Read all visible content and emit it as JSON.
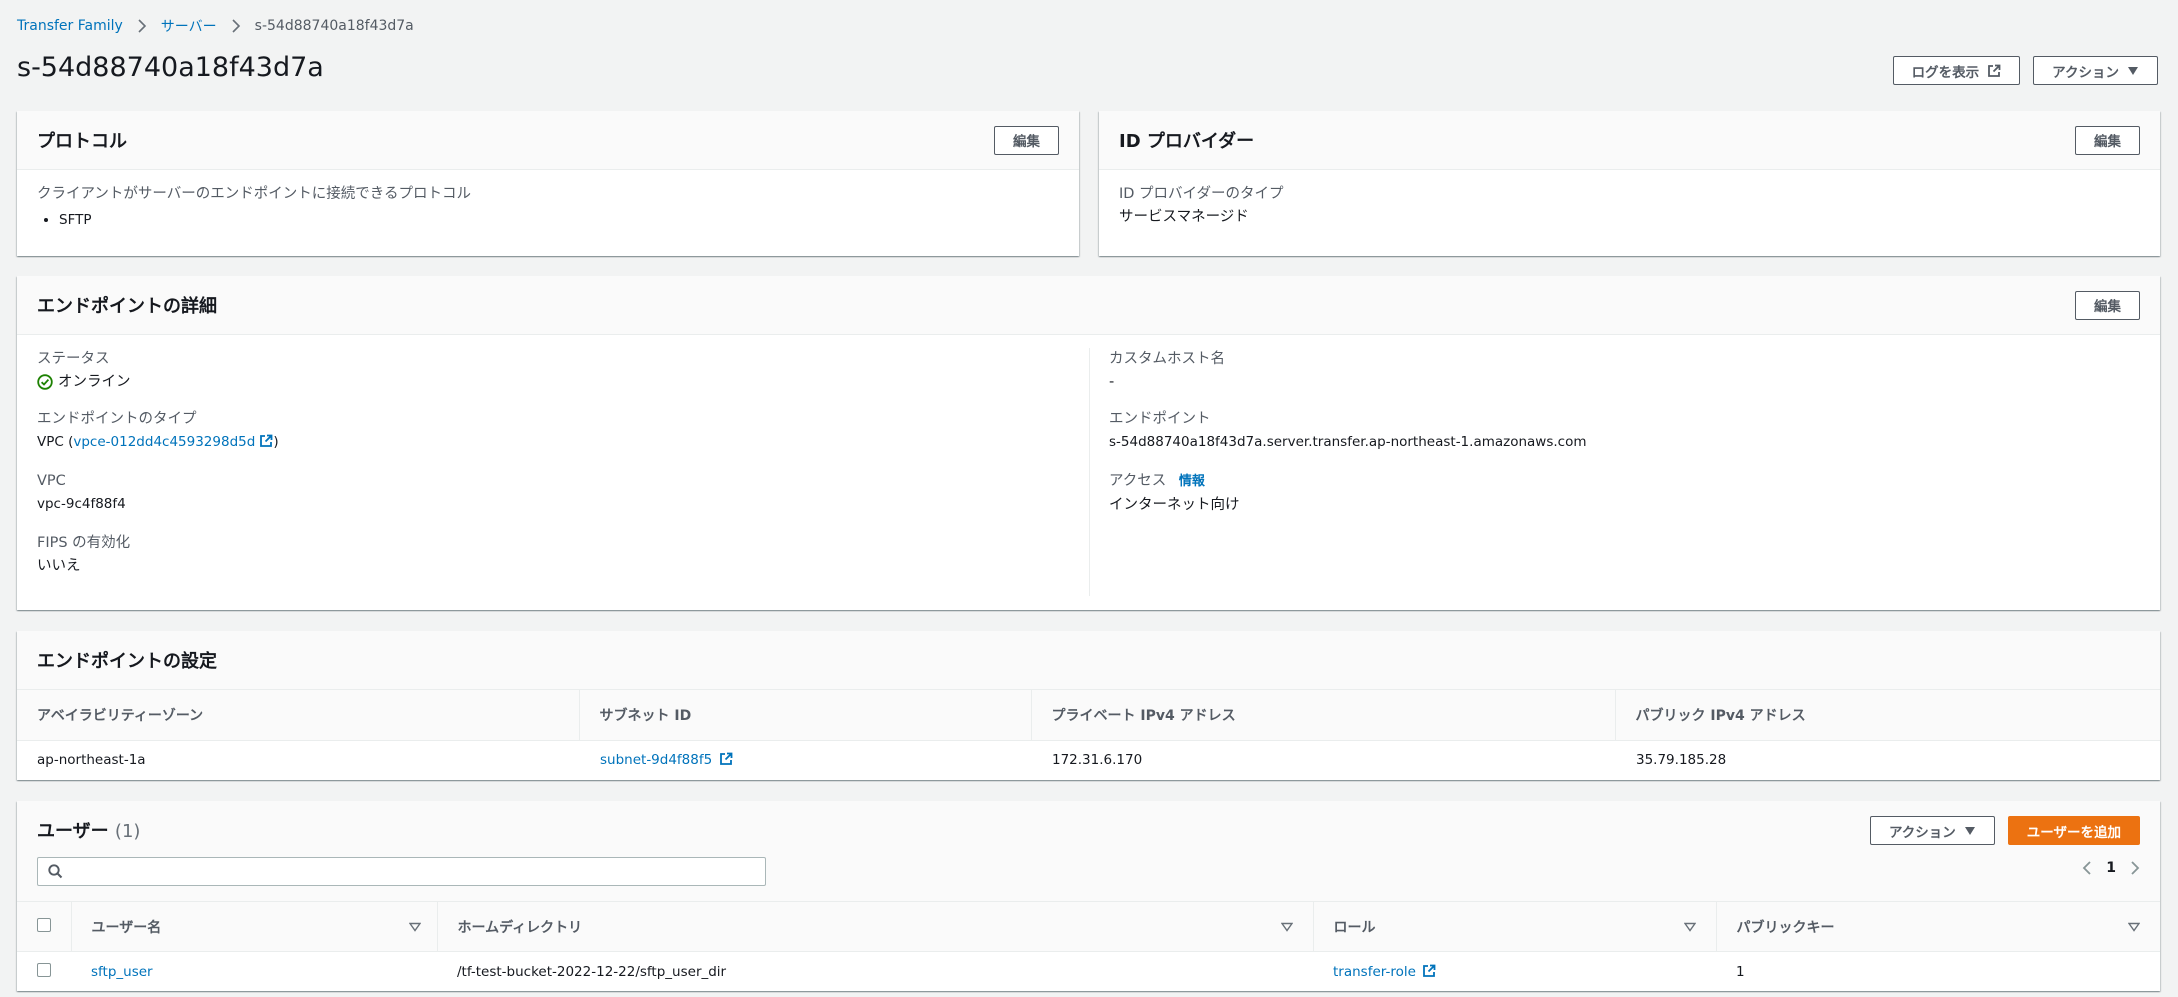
{
  "breadcrumb": {
    "root": "Transfer Family",
    "servers": "サーバー",
    "current": "s-54d88740a18f43d7a"
  },
  "page": {
    "title": "s-54d88740a18f43d7a",
    "view_logs": "ログを表示",
    "actions": "アクション"
  },
  "protocol": {
    "title": "プロトコル",
    "edit": "編集",
    "label": "クライアントがサーバーのエンドポイントに接続できるプロトコル",
    "items": [
      "SFTP"
    ]
  },
  "idp": {
    "title": "ID プロバイダー",
    "edit": "編集",
    "label": "ID プロバイダーのタイプ",
    "value": "サービスマネージド"
  },
  "endpoint_details": {
    "title": "エンドポイントの詳細",
    "edit": "編集",
    "status_label": "ステータス",
    "status_value": "オンライン",
    "type_label": "エンドポイントのタイプ",
    "type_prefix": "VPC (",
    "type_link": "vpce-012dd4c4593298d5d",
    "type_suffix": ")",
    "vpc_label": "VPC",
    "vpc_value": "vpc-9c4f88f4",
    "fips_label": "FIPS の有効化",
    "fips_value": "いいえ",
    "custom_host_label": "カスタムホスト名",
    "custom_host_value": "-",
    "endpoint_label": "エンドポイント",
    "endpoint_value": "s-54d88740a18f43d7a.server.transfer.ap-northeast-1.amazonaws.com",
    "access_label": "アクセス",
    "access_info": "情報",
    "access_value": "インターネット向け"
  },
  "endpoint_config": {
    "title": "エンドポイントの設定",
    "headers": [
      "アベイラビリティーゾーン",
      "サブネット ID",
      "プライベート IPv4 アドレス",
      "パブリック IPv4 アドレス"
    ],
    "row": {
      "az": "ap-northeast-1a",
      "subnet": "subnet-9d4f88f5",
      "private_ip": "172.31.6.170",
      "public_ip": "35.79.185.28"
    }
  },
  "users": {
    "title": "ユーザー",
    "count": "(1)",
    "actions": "アクション",
    "add_user": "ユーザーを追加",
    "search_placeholder": "",
    "page": "1",
    "headers": [
      "ユーザー名",
      "ホームディレクトリ",
      "ロール",
      "パブリックキー"
    ],
    "row": {
      "username": "sftp_user",
      "home": "/tf-test-bucket-2022-12-22/sftp_user_dir",
      "role": "transfer-role",
      "public_keys": "1"
    }
  },
  "colors": {
    "link": "#0073bb",
    "primary": "#ec7211",
    "success": "#1d8102"
  }
}
